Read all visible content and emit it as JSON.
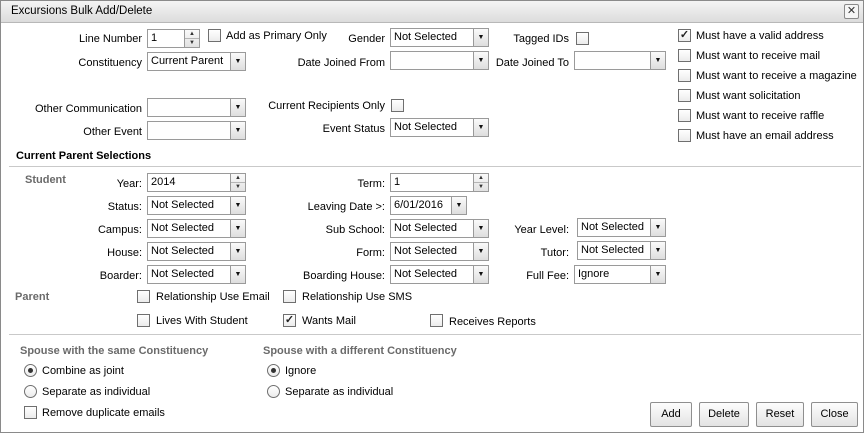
{
  "window": {
    "title": "Excursions Bulk Add/Delete",
    "close_glyph": "✕"
  },
  "filters": {
    "line_number_label": "Line Number",
    "line_number_value": "1",
    "add_primary_only_label": "Add as Primary Only",
    "add_primary_only_checked": false,
    "gender_label": "Gender",
    "gender_value": "Not Selected",
    "tagged_ids_label": "Tagged IDs",
    "tagged_ids_checked": false,
    "constituency_label": "Constituency",
    "constituency_value": "Current Parent",
    "date_joined_from_label": "Date Joined From",
    "date_joined_from_value": "",
    "date_joined_to_label": "Date Joined To",
    "date_joined_to_value": "",
    "other_communication_label": "Other Communication",
    "other_communication_value": "",
    "current_recipients_only_label": "Current Recipients Only",
    "current_recipients_only_checked": false,
    "other_event_label": "Other Event",
    "other_event_value": "",
    "event_status_label": "Event Status",
    "event_status_value": "Not Selected"
  },
  "requirements": [
    {
      "label": "Must have a valid address",
      "checked": true
    },
    {
      "label": "Must want to receive mail",
      "checked": false
    },
    {
      "label": "Must want to receive a magazine",
      "checked": false
    },
    {
      "label": "Must want solicitation",
      "checked": false
    },
    {
      "label": "Must want to receive raffle",
      "checked": false
    },
    {
      "label": "Must have an email address",
      "checked": false
    }
  ],
  "parent_selections": {
    "heading": "Current Parent Selections",
    "student_label": "Student",
    "year_label": "Year:",
    "year_value": "2014",
    "term_label": "Term:",
    "term_value": "1",
    "status_label": "Status:",
    "status_value": "Not Selected",
    "leaving_date_label": "Leaving Date >:",
    "leaving_date_value": "6/01/2016",
    "campus_label": "Campus:",
    "campus_value": "Not Selected",
    "sub_school_label": "Sub School:",
    "sub_school_value": "Not Selected",
    "year_level_label": "Year Level:",
    "year_level_value": "Not Selected",
    "house_label": "House:",
    "house_value": "Not Selected",
    "form_label": "Form:",
    "form_value": "Not Selected",
    "tutor_label": "Tutor:",
    "tutor_value": "Not Selected",
    "boarder_label": "Boarder:",
    "boarder_value": "Not Selected",
    "boarding_house_label": "Boarding House:",
    "boarding_house_value": "Not Selected",
    "full_fee_label": "Full Fee:",
    "full_fee_value": "Ignore",
    "parent_label": "Parent",
    "rel_email_label": "Relationship Use Email",
    "rel_email_checked": false,
    "rel_sms_label": "Relationship Use SMS",
    "rel_sms_checked": false,
    "lives_with_label": "Lives With Student",
    "lives_with_checked": false,
    "wants_mail_label": "Wants Mail",
    "wants_mail_checked": true,
    "receives_reports_label": "Receives Reports",
    "receives_reports_checked": false
  },
  "spouse": {
    "same_heading": "Spouse with the same Constituency",
    "same_options": [
      {
        "label": "Combine as joint",
        "selected": true
      },
      {
        "label": "Separate as individual",
        "selected": false
      }
    ],
    "different_heading": "Spouse with a different Constituency",
    "different_options": [
      {
        "label": "Ignore",
        "selected": true
      },
      {
        "label": "Separate as individual",
        "selected": false
      }
    ],
    "remove_duplicates_label": "Remove duplicate emails",
    "remove_duplicates_checked": false
  },
  "buttons": {
    "add": "Add",
    "delete": "Delete",
    "reset": "Reset",
    "close": "Close"
  },
  "icons": {
    "select_arrow": "▼",
    "spin_up": "▲",
    "spin_down": "▼",
    "calendar_arrow": "▼"
  }
}
